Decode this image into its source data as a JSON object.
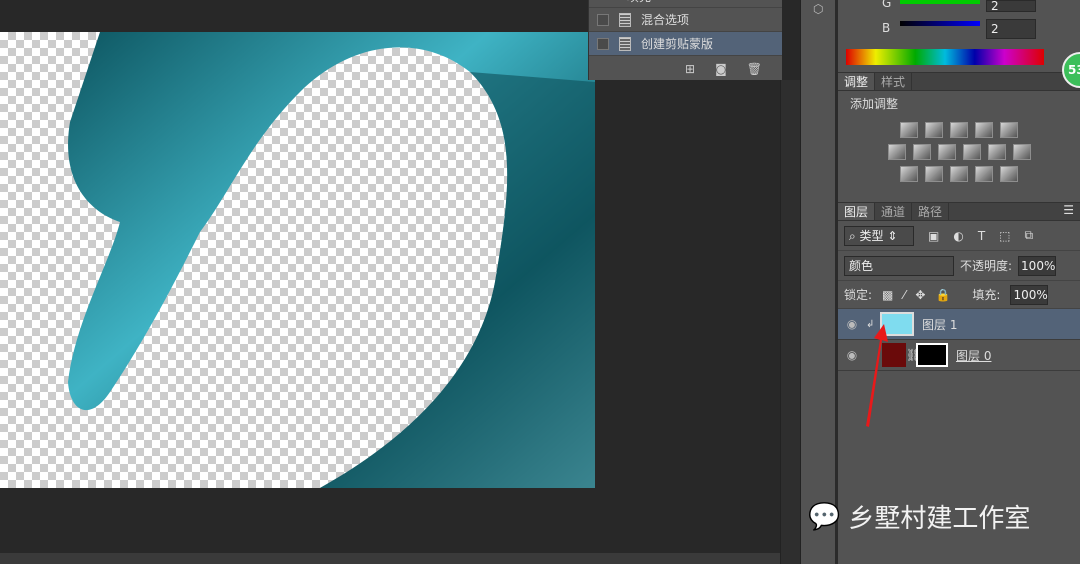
{
  "style_panel": {
    "items": [
      {
        "label": "填充"
      },
      {
        "label": "混合选项"
      },
      {
        "label": "创建剪贴蒙版",
        "selected": true
      }
    ]
  },
  "color_panel": {
    "g_label": "G",
    "g_value": "2",
    "b_label": "B",
    "b_value": "2"
  },
  "badge": "53",
  "adjust_panel": {
    "tabs": [
      "调整",
      "样式"
    ],
    "heading": "添加调整"
  },
  "layers_panel": {
    "tabs": [
      "图层",
      "通道",
      "路径"
    ],
    "filter_label": "类型",
    "blend_mode": "颜色",
    "opacity_label": "不透明度:",
    "opacity": "100%",
    "lock_label": "锁定:",
    "fill_label": "填充:",
    "fill": "100%",
    "layers": [
      {
        "name": "图层 1",
        "swatch": "#7fdcef",
        "selected": true,
        "clipped": true
      },
      {
        "name": "图层 0",
        "selected": false
      }
    ]
  },
  "watermark": "乡墅村建工作室",
  "colors": {
    "accent_selected": "#536378",
    "panel_bg": "#535353",
    "teal": "#1b7f8f",
    "arrow": "#e8191a"
  }
}
